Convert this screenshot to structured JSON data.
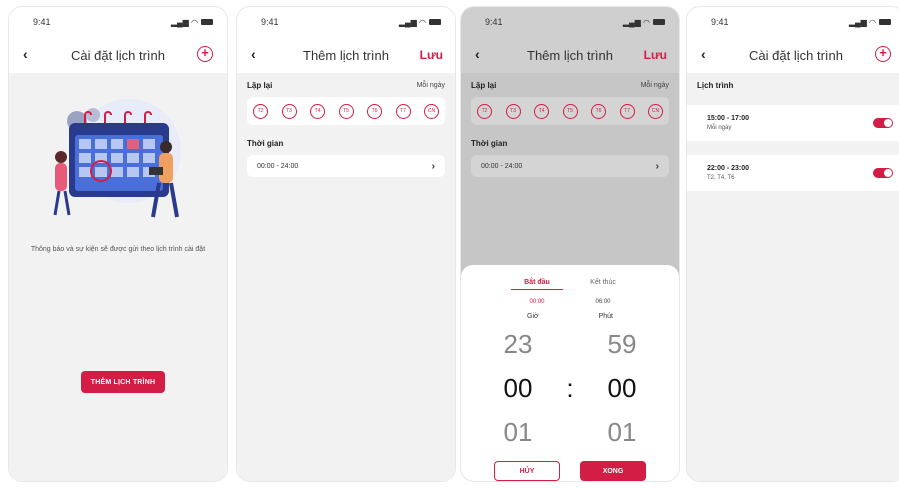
{
  "status_time": "9:41",
  "screens": {
    "s1": {
      "title": "Cài đặt lịch trình",
      "empty_text": "Thông báo và sự kiện sẽ được gửi theo lịch trình cài đặt",
      "add_button": "THÊM LỊCH TRÌNH"
    },
    "s2": {
      "title": "Thêm lịch trình",
      "save": "Lưu",
      "repeat_label": "Lặp lại",
      "repeat_value": "Mỗi ngày",
      "days": [
        "T2",
        "T3",
        "T4",
        "T5",
        "T6",
        "T7",
        "CN"
      ],
      "time_label": "Thời gian",
      "time_value": "00:00 - 24:00"
    },
    "s3": {
      "tab_start": "Bắt đầu",
      "tab_end": "Kết thúc",
      "start_time": "00:00",
      "end_time": "06:00",
      "hour_label": "Giờ",
      "minute_label": "Phút",
      "hour_prev": "23",
      "hour_cur": "00",
      "hour_next": "01",
      "min_prev": "59",
      "min_cur": "00",
      "min_next": "01",
      "separator": ":",
      "cancel": "HỦY",
      "done": "XONG"
    },
    "s4": {
      "title": "Cài đặt lịch trình",
      "section": "Lịch trình",
      "items": [
        {
          "time": "15:00 - 17:00",
          "repeat": "Mỗi ngày"
        },
        {
          "time": "22:00 - 23:00",
          "repeat": "T2, T4, T6"
        }
      ]
    }
  },
  "colors": {
    "accent": "#d21e45"
  }
}
